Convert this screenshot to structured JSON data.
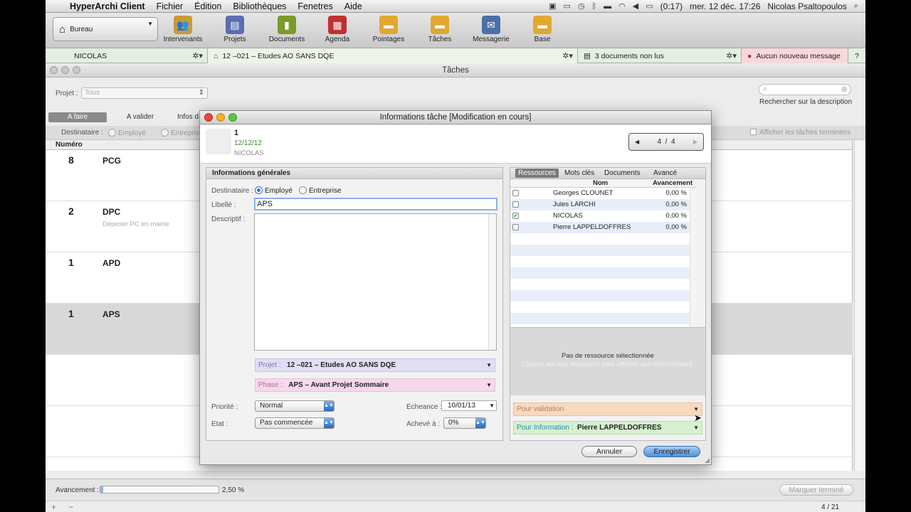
{
  "menubar": {
    "app_name": "HyperArchi Client",
    "items": [
      "Fichier",
      "Édition",
      "Bibliothèques",
      "Fenetres",
      "Aide"
    ],
    "battery": "(0:17)",
    "datetime": "mer. 12 déc.  17:26",
    "user": "Nicolas Psaltopoulos"
  },
  "toolbar": {
    "bureau_label": "Bureau",
    "buttons": [
      {
        "label": "Intervenants",
        "icon": "people-icon",
        "color": "#c89a3a"
      },
      {
        "label": "Projets",
        "icon": "projects-icon",
        "color": "#5a6fb0"
      },
      {
        "label": "Documents",
        "icon": "document-icon",
        "color": "#7a9a2a"
      },
      {
        "label": "Agenda",
        "icon": "calendar-icon",
        "color": "#c03030"
      },
      {
        "label": "Pointages",
        "icon": "folder-icon",
        "color": "#e0a830"
      },
      {
        "label": "Tâches",
        "icon": "tasks-icon",
        "color": "#e0a830"
      },
      {
        "label": "Messagerie",
        "icon": "messaging-icon",
        "color": "#4a70a8"
      },
      {
        "label": "Base",
        "icon": "database-icon",
        "color": "#e0a830"
      }
    ]
  },
  "statusrow": {
    "user": "NICOLAS",
    "project": "12 –021 – Etudes AO SANS DQE",
    "documents": "3 documents non lus",
    "messages": "Aucun nouveau message",
    "help": "?"
  },
  "window": {
    "title": "Tâches",
    "projet_label": "Projet :",
    "projet_value": "Tous",
    "search_caption": "Rechercher sur la description",
    "tabs": [
      "A faire",
      "A valider",
      "Infos d"
    ],
    "destinataire_label": "Destinataire :",
    "dest_options": [
      "Employé",
      "Entrepris"
    ],
    "show_done_label": "Afficher les tâches terminées",
    "column_numero": "Numéro",
    "rows": [
      {
        "num": "8",
        "code": "PCG",
        "sub": ""
      },
      {
        "num": "2",
        "code": "DPC",
        "sub": "Déposer PC en mairie"
      },
      {
        "num": "1",
        "code": "APD",
        "sub": ""
      },
      {
        "num": "1",
        "code": "APS",
        "sub": ""
      }
    ],
    "avancement_label": "Avancement :",
    "avancement_value": "2,50 %",
    "avancement_fraction": 0.025,
    "mark_done_label": "Marquer terminé",
    "count": "4 / 21"
  },
  "modal": {
    "title": "Informations tâche [Modification en cours]",
    "head_num": "1",
    "head_date": "12/12/12",
    "head_user": "NICOLAS",
    "pager_current": "4",
    "pager_sep": "/",
    "pager_total": "4",
    "general_title": "Informations générales",
    "dest_label": "Destinataire :",
    "dest_employe": "Employé",
    "dest_entreprise": "Entreprise",
    "libelle_label": "Libellé :",
    "libelle_value": "APS",
    "descriptif_label": "Descriptif :",
    "projet_label": "Projet :",
    "projet_value": "12 –021 – Etudes AO SANS DQE",
    "phase_label": "Phase :",
    "phase_value": "APS – Avant Projet Sommaire",
    "priorite_label": "Priorité :",
    "priorite_value": "Normal",
    "etat_label": "Etat :",
    "etat_value": "Pas commencée",
    "echeance_label": "Echeance :",
    "echeance_value": "10/01/13",
    "acheve_label": "Achevé à :",
    "acheve_value": "0%",
    "right_tabs": [
      "Ressources",
      "Mots clés",
      "Documents",
      "Avancé"
    ],
    "col_nom": "Nom",
    "col_avancement": "Avancement",
    "resources": [
      {
        "name": "Georges CLOUNET",
        "value": "0,00 %",
        "checked": ""
      },
      {
        "name": "Jules LARCHI",
        "value": "0,00 %",
        "checked": ""
      },
      {
        "name": "NICOLAS",
        "value": "0,00 %",
        "checked": "✔"
      },
      {
        "name": "Pierre LAPPELDOFFRES",
        "value": "0,00 %",
        "checked": ""
      }
    ],
    "no_resource": "Pas de ressource sélectionnée",
    "no_resource_hint": "Cliquez sur une ressource pour afficher son commentaire.",
    "validation_placeholder": "Pour validation",
    "info_label": "Pour Information :",
    "info_value": "Pierre LAPPELDOFFRES",
    "cancel_label": "Annuler",
    "save_label": "Enregistrer"
  }
}
